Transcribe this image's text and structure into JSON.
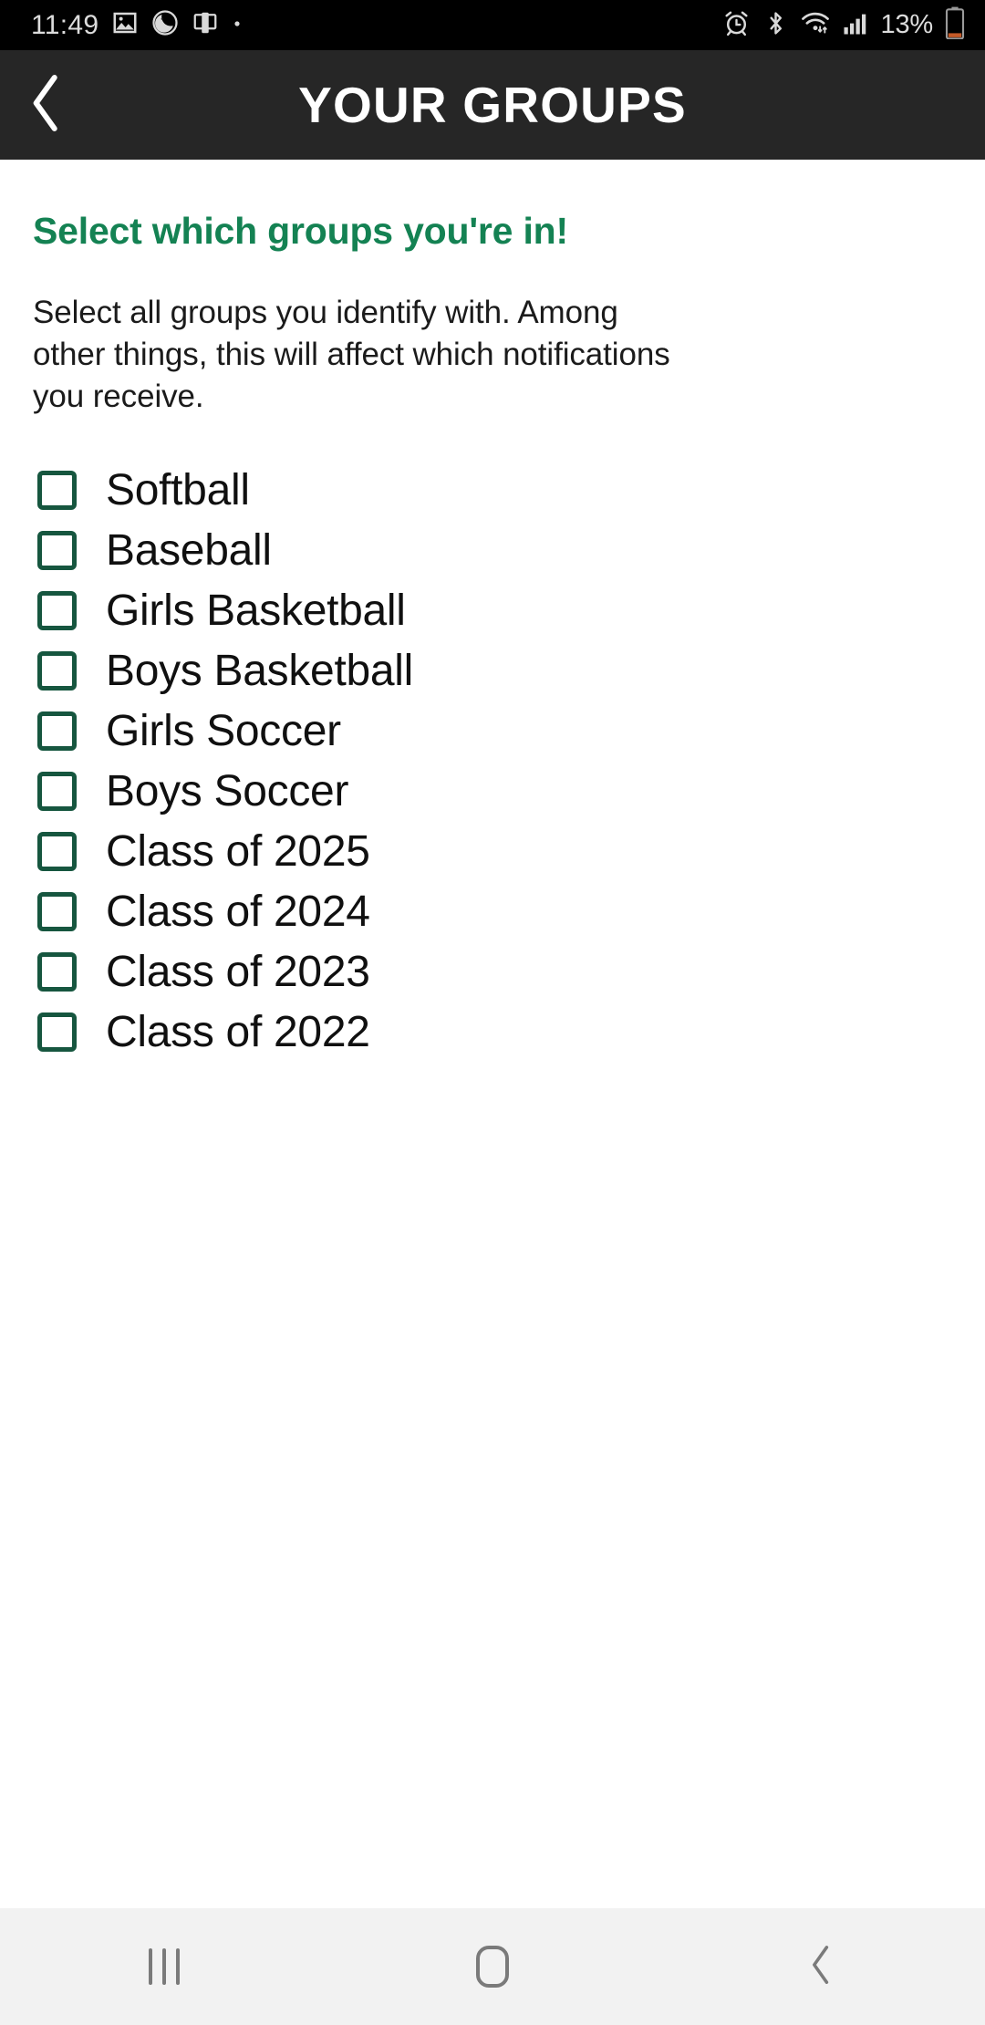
{
  "status_bar": {
    "clock": "11:49",
    "battery_percent": "13%",
    "left_icons": [
      "image-icon",
      "do-not-disturb-icon",
      "screen-mirror-icon",
      "dot-icon"
    ],
    "right_icons": [
      "alarm-icon",
      "bluetooth-icon",
      "wifi-icon",
      "signal-icon",
      "battery-icon"
    ],
    "colors": {
      "background": "#000000",
      "text": "#dcdcdc",
      "battery_low": "#c45a28"
    }
  },
  "app_bar": {
    "title": "YOUR GROUPS",
    "back_icon": "chevron-left-icon",
    "colors": {
      "background": "#262626",
      "text": "#ffffff"
    }
  },
  "content": {
    "heading": "Select which groups you're in!",
    "description": "Select all groups you identify with. Among other things, this will affect which notifications you receive.",
    "heading_color": "#148253",
    "checkbox_color": "#16563f",
    "groups": [
      {
        "label": "Softball",
        "checked": false
      },
      {
        "label": "Baseball",
        "checked": false
      },
      {
        "label": "Girls Basketball",
        "checked": false
      },
      {
        "label": "Boys Basketball",
        "checked": false
      },
      {
        "label": "Girls Soccer",
        "checked": false
      },
      {
        "label": "Boys Soccer",
        "checked": false
      },
      {
        "label": "Class of 2025",
        "checked": false
      },
      {
        "label": "Class of 2024",
        "checked": false
      },
      {
        "label": "Class of 2023",
        "checked": false
      },
      {
        "label": "Class of 2022",
        "checked": false
      }
    ]
  },
  "nav_bar": {
    "buttons": [
      {
        "name": "recents",
        "icon": "recents-icon"
      },
      {
        "name": "home",
        "icon": "home-icon"
      },
      {
        "name": "back",
        "icon": "chevron-left-icon"
      }
    ],
    "colors": {
      "background": "#f2f2f2",
      "icon": "#7a7a7a"
    }
  }
}
